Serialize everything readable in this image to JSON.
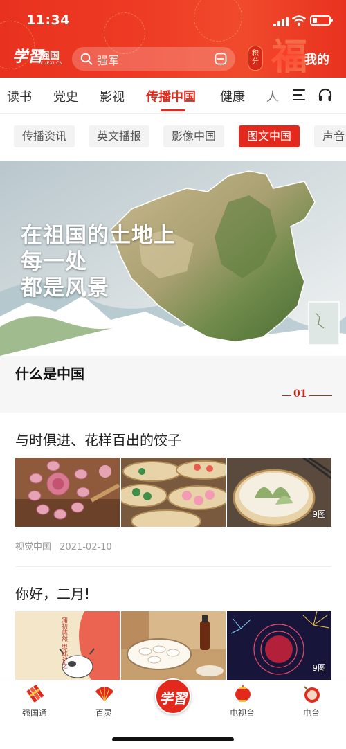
{
  "status_bar": {
    "time": "11:34"
  },
  "header": {
    "logo_script": "学習",
    "logo_text": "强国",
    "logo_sub": "XUEXI.CN",
    "search_placeholder": "强军",
    "points_label": "积分",
    "mine_label": "我的",
    "blessing_char": "福"
  },
  "channel_tabs": [
    "读书",
    "党史",
    "影视",
    "传播中国",
    "健康",
    "人"
  ],
  "active_channel": "传播中国",
  "sub_tabs": [
    "传播资讯",
    "英文播报",
    "影像中国",
    "图文中国",
    "声音"
  ],
  "active_sub_tab": "图文中国",
  "banner": {
    "lines": [
      "在祖国的土地上",
      "每一处",
      "都是风景"
    ],
    "caption": "什么是中国",
    "page_number": "01"
  },
  "articles": [
    {
      "title": "与时俱进、花样百出的饺子",
      "image_count_label": "9图",
      "source": "视觉中国",
      "date": "2021-02-10"
    },
    {
      "title": "你好，二月!",
      "image_count_label": "9图",
      "poem_lines": [
        "蒲初悠然 思此谷之"
      ]
    }
  ],
  "bottom_nav": [
    {
      "label": "强国通",
      "icon": "firecracker-icon"
    },
    {
      "label": "百灵",
      "icon": "fan-icon"
    },
    {
      "label": "学習",
      "icon": "study-logo-icon"
    },
    {
      "label": "电视台",
      "icon": "lantern-icon"
    },
    {
      "label": "电台",
      "icon": "drum-icon"
    }
  ],
  "colors": {
    "brand_red": "#e2291c",
    "header_red": "#ee3b24"
  }
}
